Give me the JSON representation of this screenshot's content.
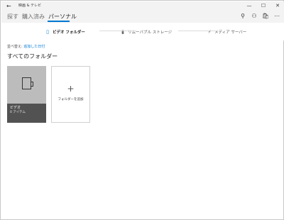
{
  "window": {
    "title": "映画 & テレビ",
    "back_icon": "←",
    "minimize_icon": "—",
    "maximize_icon": "☐",
    "close_icon": "✕"
  },
  "header": {
    "tabs": [
      {
        "label": "探す",
        "active": false
      },
      {
        "label": "購入済み",
        "active": false
      },
      {
        "label": "パーソナル",
        "active": true
      }
    ],
    "icons": {
      "search": "⚲",
      "account": "⚇",
      "store": "🛍",
      "more": "⋯"
    },
    "accent_color": "#0078d4"
  },
  "subnav": {
    "items": [
      {
        "label": "ビデオ フォルダー",
        "icon": "▯",
        "active": true
      },
      {
        "label": "リムーバブル ストレージ",
        "icon": "▮",
        "active": false
      },
      {
        "label": "メディア サーバー",
        "icon": "⚡",
        "active": false
      }
    ]
  },
  "sort": {
    "label": "並べ替え:",
    "value": "追加した日付"
  },
  "section": {
    "title": "すべてのフォルダー"
  },
  "folders": [
    {
      "name": "ビデオ",
      "count": "0 アイテム"
    }
  ],
  "add_folder": {
    "plus": "+",
    "label": "フォルダーを追加"
  }
}
